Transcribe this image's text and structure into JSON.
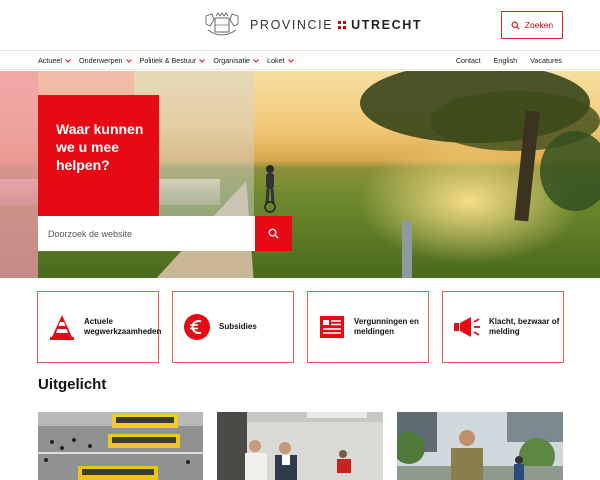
{
  "header": {
    "brand_left": "PROVINCIE",
    "brand_right": "UTRECHT",
    "search_button": "Zoeken",
    "search_icon": "search-icon",
    "colors": {
      "accent": "#e60a14",
      "border": "#e3261c"
    }
  },
  "nav": {
    "primary": [
      {
        "label": "Actueel"
      },
      {
        "label": "Onderwerpen"
      },
      {
        "label": "Politiek & Bestuur"
      },
      {
        "label": "Organisatie"
      },
      {
        "label": "Loket"
      }
    ],
    "secondary": [
      {
        "label": "Contact"
      },
      {
        "label": "English"
      },
      {
        "label": "Vacatures"
      }
    ]
  },
  "hero": {
    "heading": "Waar kunnen we u mee helpen?",
    "search_placeholder": "Doorzoek de website"
  },
  "tiles": [
    {
      "label": "Actuele wegwerkzaamheden",
      "icon": "traffic-cone-icon"
    },
    {
      "label": "Subsidies",
      "icon": "euro-icon"
    },
    {
      "label": "Vergunningen en meldingen",
      "icon": "document-icon"
    },
    {
      "label": "Klacht, bezwaar of melding",
      "icon": "megaphone-icon"
    }
  ],
  "featured": {
    "title": "Uitgelicht"
  }
}
